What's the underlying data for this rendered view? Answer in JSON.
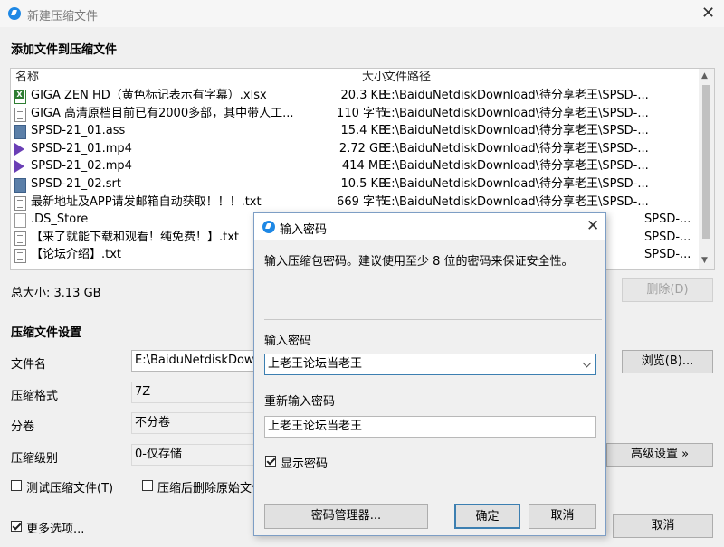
{
  "window": {
    "title": "新建压缩文件",
    "close_glyph": "✕"
  },
  "section_add": "添加文件到压缩文件",
  "filelist": {
    "columns": {
      "name": "名称",
      "size": "大小",
      "path": "文件路径"
    },
    "rows": [
      {
        "icon": "excel-file-icon",
        "name": "GIGA ZEN HD（黄色标记表示有字幕）.xlsx",
        "size": "20.3 KB",
        "path": "E:\\BaiduNetdiskDownload\\待分享老王\\SPSD-..."
      },
      {
        "icon": "text-file-icon",
        "name": "GIGA 高清原档目前已有2000多部，其中带人工...",
        "size": "110 字节",
        "path": "E:\\BaiduNetdiskDownload\\待分享老王\\SPSD-..."
      },
      {
        "icon": "subtitle-file-icon",
        "name": "SPSD-21_01.ass",
        "size": "15.4 KB",
        "path": "E:\\BaiduNetdiskDownload\\待分享老王\\SPSD-..."
      },
      {
        "icon": "video-file-icon",
        "name": "SPSD-21_01.mp4",
        "size": "2.72 GB",
        "path": "E:\\BaiduNetdiskDownload\\待分享老王\\SPSD-..."
      },
      {
        "icon": "video-file-icon",
        "name": "SPSD-21_02.mp4",
        "size": "414 MB",
        "path": "E:\\BaiduNetdiskDownload\\待分享老王\\SPSD-..."
      },
      {
        "icon": "subtitle-file-icon",
        "name": "SPSD-21_02.srt",
        "size": "10.5 KB",
        "path": "E:\\BaiduNetdiskDownload\\待分享老王\\SPSD-..."
      },
      {
        "icon": "text-file-icon",
        "name": "最新地址及APP请发邮箱自动获取！！！.txt",
        "size": "669 字节",
        "path": "E:\\BaiduNetdiskDownload\\待分享老王\\SPSD-..."
      },
      {
        "icon": "blank-file-icon",
        "name": ".DS_Store",
        "size": "",
        "path": "SPSD-..."
      },
      {
        "icon": "text-file-icon",
        "name": "【来了就能下载和观看！纯免费！】.txt",
        "size": "",
        "path": "SPSD-..."
      },
      {
        "icon": "text-file-icon",
        "name": "【论坛介绍】.txt",
        "size": "",
        "path": "SPSD-..."
      }
    ]
  },
  "total_size": "总大小: 3.13 GB",
  "delete_button": "删除(D)",
  "section_settings": "压缩文件设置",
  "settings": {
    "filename_label": "文件名",
    "filename_value": "E:\\BaiduNetdiskDown",
    "browse_button": "浏览(B)...",
    "format_label": "压缩格式",
    "format_value": "7Z",
    "split_label": "分卷",
    "split_value": "不分卷",
    "level_label": "压缩级别",
    "level_value": "0-仅存储",
    "advanced_button": "高级设置 »",
    "test_checkbox": "测试压缩文件(T)",
    "delete_after_checkbox": "压缩后删除原始文件",
    "more_options_checkbox": "更多选项...",
    "cancel_button": "取消"
  },
  "dialog": {
    "title": "输入密码",
    "description": "输入压缩包密码。建议使用至少 8 位的密码来保证安全性。",
    "password_label": "输入密码",
    "password_value": "上老王论坛当老王",
    "confirm_label": "重新输入密码",
    "confirm_value": "上老王论坛当老王",
    "show_password": "显示密码",
    "manager_button": "密码管理器...",
    "ok_button": "确定",
    "cancel_button": "取消"
  },
  "colors": {
    "accent": "#1e88e5",
    "dialog_border": "#7d9ec5",
    "focus_border": "#3c7fb1"
  }
}
